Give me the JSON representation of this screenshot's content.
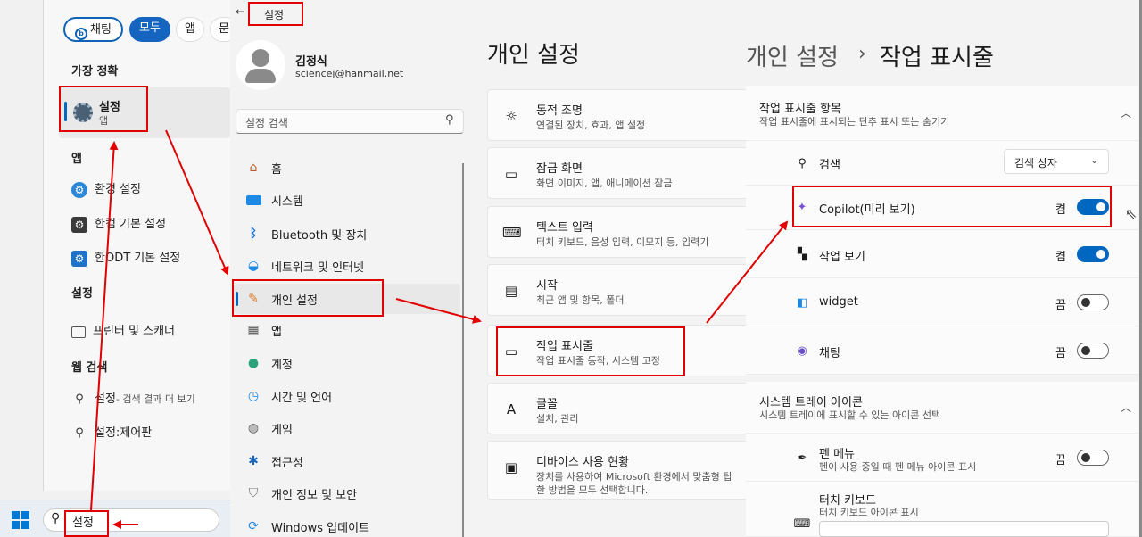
{
  "start": {
    "pills": [
      "채팅",
      "모두",
      "앱",
      "문"
    ],
    "best_match_header": "가장 정확",
    "best_match": {
      "title": "설정",
      "subtitle": "앱"
    },
    "apps_header": "앱",
    "apps": [
      "환경 설정",
      "한컴 기본 설정",
      "한ODT 기본 설정"
    ],
    "settings_header": "설정",
    "settings": [
      "프린터 및 스캐너"
    ],
    "web_header": "웹 검색",
    "web": [
      {
        "title": "설정",
        "suffix": " - 검색 결과 더 보기"
      },
      {
        "title": "설정:제어판",
        "suffix": ""
      }
    ],
    "search_value": "설정"
  },
  "settings_app": {
    "title_chip": "설정",
    "user_name": "김정식",
    "user_email": "sciencej@hanmail.net",
    "search_placeholder": "설정 검색",
    "nav": [
      "홈",
      "시스템",
      "Bluetooth 및 장치",
      "네트워크 및 인터넷",
      "개인 설정",
      "앱",
      "계정",
      "시간 및 언어",
      "게임",
      "접근성",
      "개인 정보 및 보안",
      "Windows 업데이트"
    ],
    "page_title": "개인 설정",
    "cards": [
      {
        "title": "동적 조명",
        "sub": "연결된 장치, 효과, 앱 설정"
      },
      {
        "title": "잠금 화면",
        "sub": "화면 이미지, 앱, 애니메이션 잠금"
      },
      {
        "title": "텍스트 입력",
        "sub": "터치 키보드, 음성 입력, 이모지 등, 입력기"
      },
      {
        "title": "시작",
        "sub": "최근 앱 및 항목, 폴더"
      },
      {
        "title": "작업 표시줄",
        "sub": "작업 표시줄 동작, 시스템 고정"
      },
      {
        "title": "글꼴",
        "sub": "설치, 관리"
      },
      {
        "title": "디바이스 사용 현황",
        "sub": "장치를 사용하여 Microsoft 환경에서 맞춤형 팁",
        "sub2": "한 방법을 모두 선택합니다."
      }
    ]
  },
  "taskbar_page": {
    "breadcrumb_parent": "개인 설정",
    "breadcrumb_sep": "›",
    "breadcrumb_current": "작업 표시줄",
    "section1": {
      "title": "작업 표시줄 항목",
      "sub": "작업 표시줄에 표시되는 단추 표시 또는 숨기기"
    },
    "search_row": {
      "label": "검색",
      "value": "검색 상자"
    },
    "items": [
      {
        "label": "Copilot(미리 보기)",
        "state": "켬"
      },
      {
        "label": "작업 보기",
        "state": "켬"
      },
      {
        "label": "widget",
        "state": "끔"
      },
      {
        "label": "채팅",
        "state": "끔"
      }
    ],
    "section2": {
      "title": "시스템 트레이 아이콘",
      "sub": "시스템 트레이에 표시할 수 있는 아이콘 선택"
    },
    "tray": [
      {
        "label": "펜 메뉴",
        "sub": "펜이 사용 중일 때 펜 메뉴 아이콘 표시",
        "state": "끔"
      },
      {
        "label": "터치 키보드",
        "sub": "터치 키보드 아이콘 표시"
      }
    ]
  },
  "colors": {
    "accent": "#0067c0",
    "annotation": "#e00000"
  }
}
